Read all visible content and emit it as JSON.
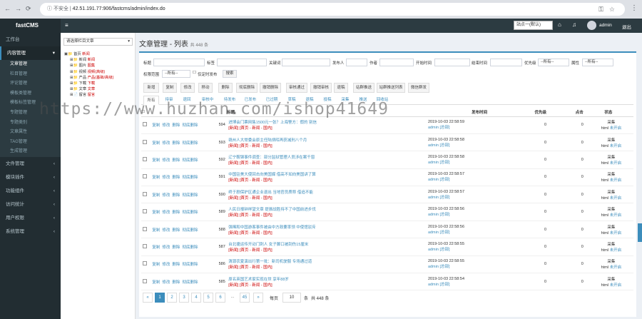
{
  "browser": {
    "insecure_label": "不安全",
    "url": "42.51.191.77:906/fastcms/admin/index.do"
  },
  "header": {
    "logo": "fastCMS",
    "site_select": "站点一(默认)",
    "user": "admin",
    "logout": "退出"
  },
  "sidebar": [
    {
      "label": "工作台",
      "chev": ""
    },
    {
      "label": "内容管理",
      "chev": "▾",
      "active": true
    },
    {
      "label": "文件管理",
      "chev": "‹"
    },
    {
      "label": "模块插件",
      "chev": "‹"
    },
    {
      "label": "功能组件",
      "chev": "‹"
    },
    {
      "label": "访问统计",
      "chev": "‹"
    },
    {
      "label": "用户权限",
      "chev": "‹"
    },
    {
      "label": "系统管理",
      "chev": "‹"
    }
  ],
  "sidebar_sub": [
    "文章管理",
    "栏目管理",
    "评论管理",
    "模板类管理",
    "模板标签管理",
    "专题管理",
    "专题类别",
    "文章属性",
    "TAG管理",
    "生成管理"
  ],
  "tree": {
    "select": "请选择栏目文章",
    "items": [
      {
        "label": "首页",
        "count": "新闻",
        "level": 1
      },
      {
        "label": "新闻",
        "count": "新闻",
        "level": 2
      },
      {
        "label": "图片",
        "count": "图集",
        "level": 2
      },
      {
        "label": "视频",
        "count": "视频(高级)",
        "level": 2
      },
      {
        "label": "产品",
        "count": "产品(基础/高级)",
        "level": 2
      },
      {
        "label": "下载",
        "count": "下载",
        "level": 2
      },
      {
        "label": "文章",
        "count": "文章",
        "level": 2
      },
      {
        "label": "留言",
        "count": "留言",
        "level": 2
      }
    ]
  },
  "page": {
    "title": "文章管理 - 列表",
    "total_badge": "共 448 条"
  },
  "search": {
    "row1": [
      "标题",
      "标签",
      "关键词",
      "发布人",
      "作者",
      "开始时间",
      "结束时间",
      "优先级",
      "属性"
    ],
    "priority": "--所有--",
    "attr": "--所有--",
    "scope_label": "权限范围",
    "scope_value": "--所有--",
    "timed_label": "仅定时发布",
    "search_btn": "搜索"
  },
  "buttons": [
    "新增",
    "复制",
    "修改",
    "移动",
    "删除",
    "彻底删除",
    "撤销删除",
    "审核通过",
    "撤销审核",
    "退稿",
    "站群推送",
    "站群推送列表",
    "微信群发"
  ],
  "tabs": [
    "所有",
    "待审",
    "退回",
    "审核中",
    "待发布",
    "已发布",
    "已过期",
    "草稿",
    "退稿",
    "投稿",
    "采集",
    "推送",
    "回收站"
  ],
  "table": {
    "headers": {
      "title": "标题",
      "date": "发布时间",
      "priority": "优先级",
      "hits": "点击",
      "status": "状态"
    },
    "ops": [
      "复制",
      "修改",
      "删除",
      "彻底删除"
    ],
    "rows": [
      {
        "id": "594",
        "title": "进博会门票网售1500元一张？上海警方：假的 别信",
        "cat": "[新闻] [首页 - 新闻 - 国内]",
        "date": "2019-10-03 22:58:59",
        "author": "admin",
        "pub": "[总部]",
        "priority": "0",
        "hits": "0",
        "s1": "采集",
        "s2": "html",
        "s3": "未开启"
      },
      {
        "id": "593",
        "title": "赣州人大常委会原主任陆炳晖再获减刑八个月",
        "cat": "[新闻] [首页 - 新闻 - 国内]",
        "date": "2019-10-03 22:58:58",
        "author": "admin",
        "pub": "[总部]",
        "priority": "0",
        "hits": "0",
        "s1": "采集",
        "s2": "html",
        "s3": "未开启"
      },
      {
        "id": "592",
        "title": "辽宁鞍钢事件调查：部分监狱管理人员涉在案千窗",
        "cat": "[新闻] [首页 - 新闻 - 国内]",
        "date": "2019-10-03 22:58:58",
        "author": "admin",
        "pub": "[总部]",
        "priority": "0",
        "hits": "0",
        "s1": "采集",
        "s2": "html",
        "s3": "未开启"
      },
      {
        "id": "591",
        "title": "中国驻美大使回击向美国媒 借高不如向美国讲了算",
        "cat": "[新闻] [首页 - 新闻 - 国内]",
        "date": "2019-10-03 22:58:57",
        "author": "admin",
        "pub": "[总部]",
        "priority": "0",
        "hits": "0",
        "s1": "采集",
        "s2": "html",
        "s3": "未开启"
      },
      {
        "id": "590",
        "title": "终于剧保护区通企业退出 当地官员质称 借追不能",
        "cat": "[新闻] [首页 - 新闻 - 国内]",
        "date": "2019-10-03 22:58:57",
        "author": "admin",
        "pub": "[总部]",
        "priority": "0",
        "hits": "0",
        "s1": "采集",
        "s2": "html",
        "s3": "未开启"
      },
      {
        "id": "589",
        "title": "人民日报钟祥望文章 提振战胜持不了中国前进步伐",
        "cat": "[新闻] [首页 - 新闻 - 国内]",
        "date": "2019-10-03 22:58:56",
        "author": "admin",
        "pub": "[总部]",
        "priority": "0",
        "hits": "0",
        "s1": "采集",
        "s2": "html",
        "s3": "未开启"
      },
      {
        "id": "588",
        "title": "强稀和中国游客事件被由中方政要率领 中使馆驳斥",
        "cat": "[新闻] [首页 - 新闻 - 国内]",
        "date": "2019-10-03 22:58:56",
        "author": "admin",
        "pub": "[总部]",
        "priority": "0",
        "hits": "0",
        "s1": "采集",
        "s2": "html",
        "s3": "未开启"
      },
      {
        "id": "587",
        "title": "台北捷运传开动门刺人 女子脚口被刮伤15厘米",
        "cat": "[新闻] [首页 - 新闻 - 国内]",
        "date": "2019-10-03 22:58:55",
        "author": "admin",
        "pub": "[总部]",
        "priority": "0",
        "hits": "0",
        "s1": "采集",
        "s2": "html",
        "s3": "未开启"
      },
      {
        "id": "586",
        "title": "渭源农夏演出行第一批：新司机驶服 专场通过道",
        "cat": "[新闻] [首页 - 新闻 - 国内]",
        "date": "2019-10-03 22:58:55",
        "author": "admin",
        "pub": "[总部]",
        "priority": "0",
        "hits": "0",
        "s1": "采集",
        "s2": "html",
        "s3": "未开启"
      },
      {
        "id": "585",
        "title": "原名英国艺术家实现在世 享年88岁",
        "cat": "[新闻] [首页 - 新闻 - 国内]",
        "date": "2019-10-03 22:58:54",
        "author": "admin",
        "pub": "[总部]",
        "priority": "0",
        "hits": "0",
        "s1": "采集",
        "s2": "html",
        "s3": "未开启"
      }
    ]
  },
  "pager": {
    "prev": "«",
    "pages": [
      "1",
      "2",
      "3",
      "4",
      "5",
      "6"
    ],
    "ellipsis": "...",
    "last": "45",
    "next": "»",
    "per_label": "每页",
    "per_value": "10",
    "unit": "条",
    "total": "共 448 条"
  },
  "watermark": "https://www.huzhan.com/ishop41649"
}
